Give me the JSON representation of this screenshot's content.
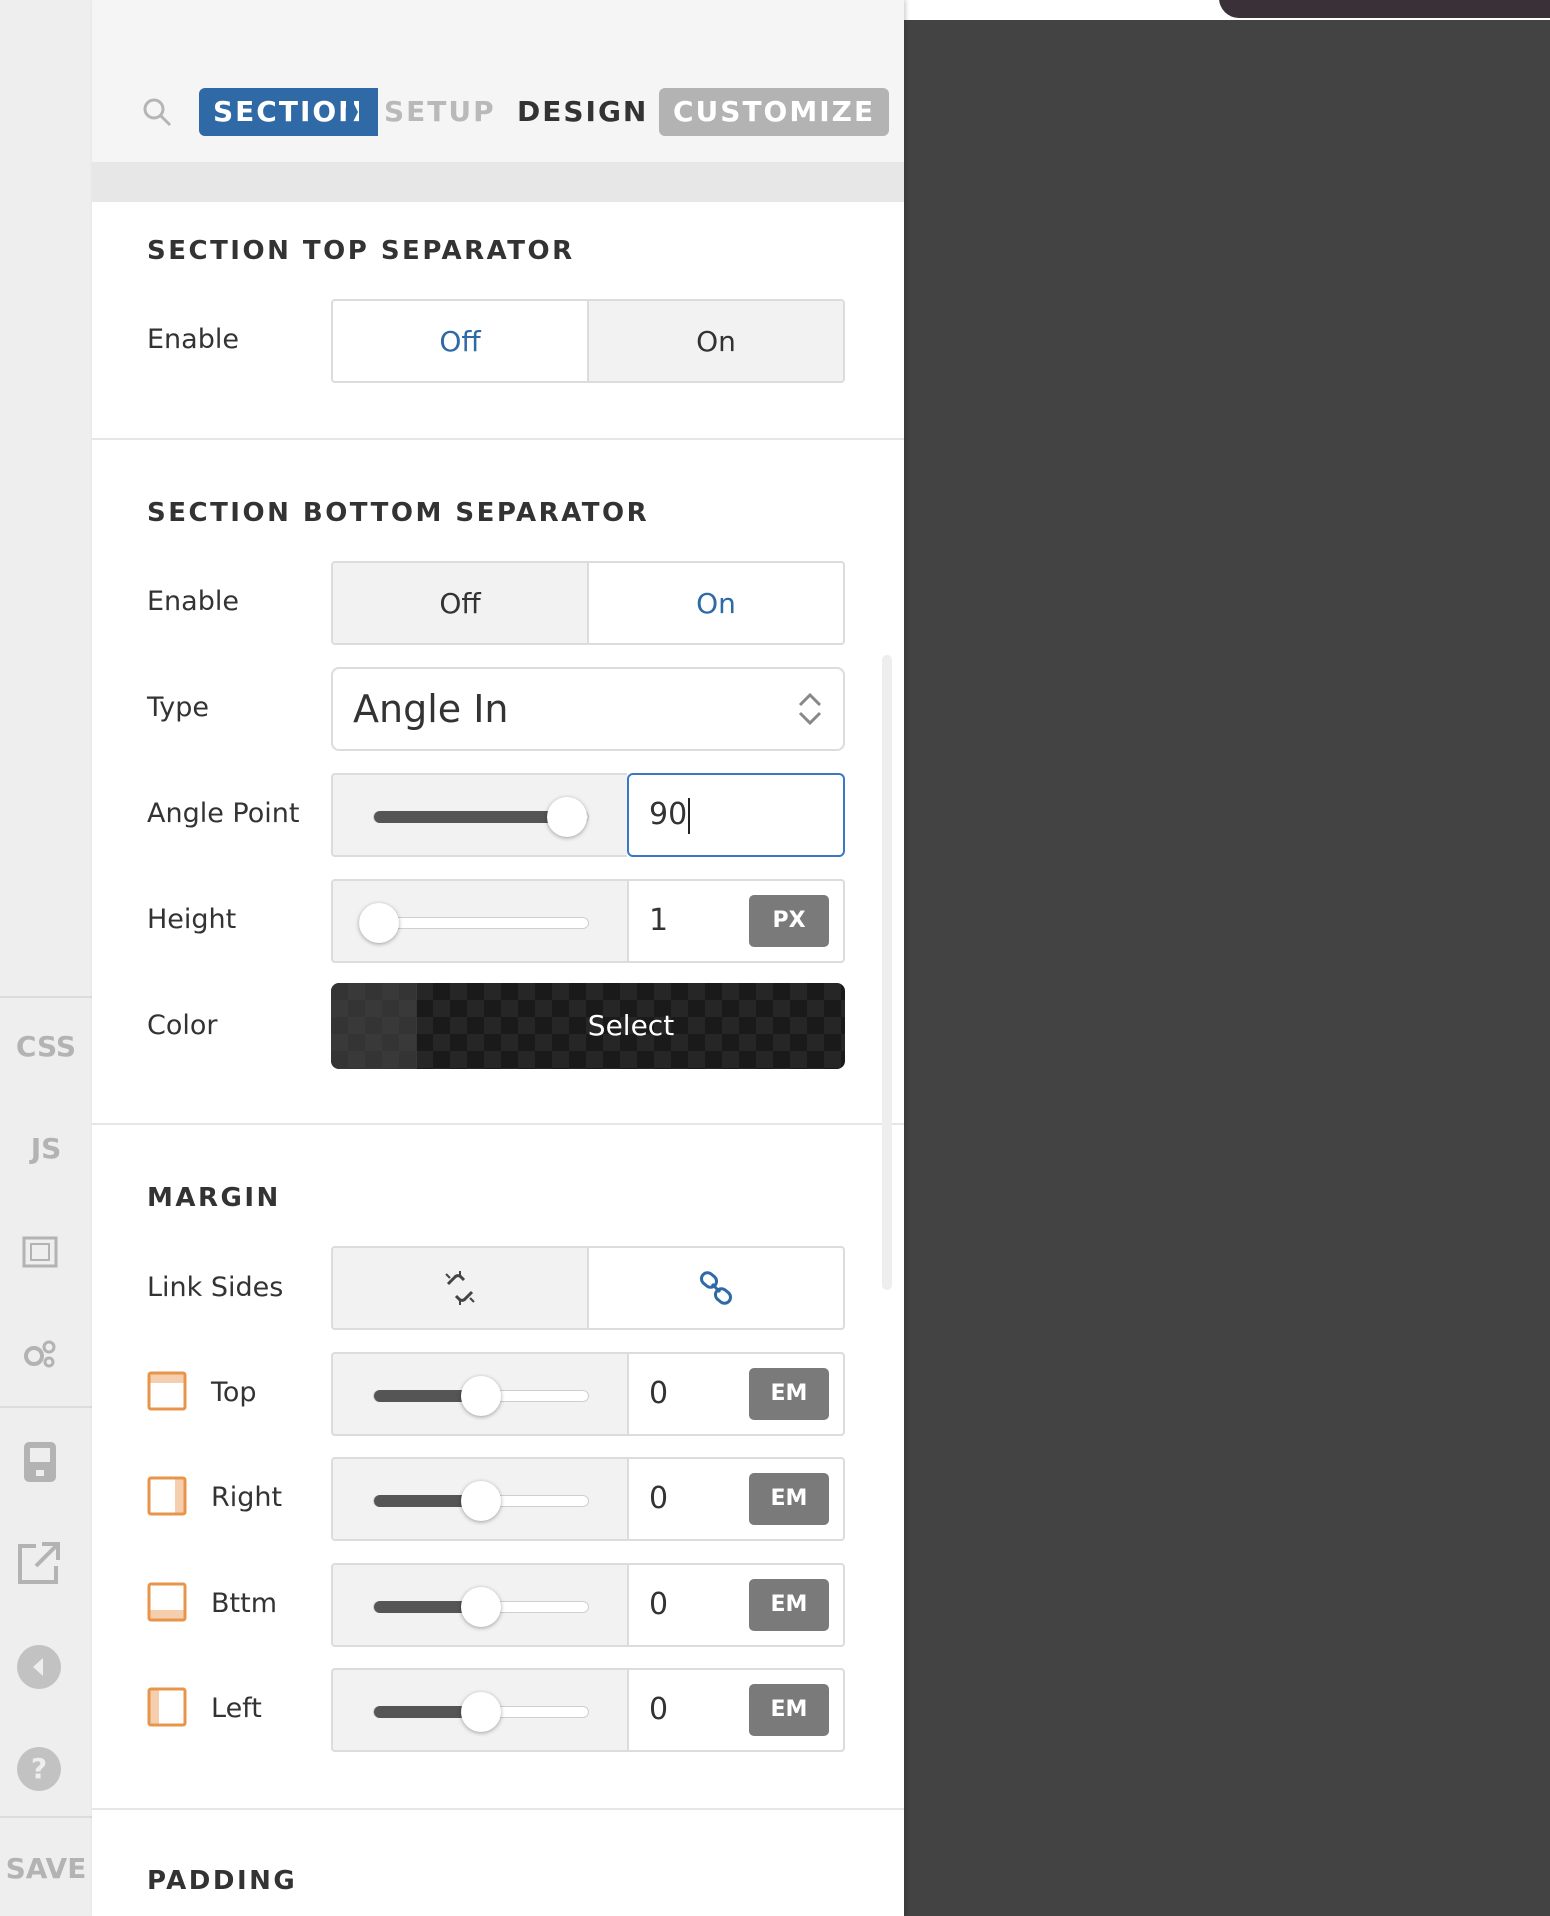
{
  "tabs": {
    "section": "SECTION",
    "setup": "SETUP",
    "design": "DESIGN",
    "customize": "CUSTOMIZE"
  },
  "rail": {
    "css": "CSS",
    "js": "JS",
    "save": "SAVE"
  },
  "top_separator": {
    "title": "SECTION TOP SEPARATOR",
    "enable_label": "Enable",
    "off": "Off",
    "on": "On",
    "selected": "Off"
  },
  "bottom_separator": {
    "title": "SECTION BOTTOM SEPARATOR",
    "enable_label": "Enable",
    "off": "Off",
    "on": "On",
    "selected": "On",
    "type_label": "Type",
    "type_value": "Angle In",
    "angle_label": "Angle Point",
    "angle_value": "90",
    "angle_fraction": 0.9,
    "height_label": "Height",
    "height_value": "1",
    "height_unit": "PX",
    "height_fraction": 0.0,
    "color_label": "Color",
    "color_button": "Select"
  },
  "margin": {
    "title": "MARGIN",
    "link_label": "Link Sides",
    "sides": [
      {
        "label": "Top",
        "value": "0",
        "unit": "EM"
      },
      {
        "label": "Right",
        "value": "0",
        "unit": "EM"
      },
      {
        "label": "Bttm",
        "value": "0",
        "unit": "EM"
      },
      {
        "label": "Left",
        "value": "0",
        "unit": "EM"
      }
    ],
    "slider_fraction": 0.5
  },
  "padding": {
    "title": "PADDING"
  },
  "colors": {
    "accent": "#2f6aa6",
    "side_icon": "#e8944a",
    "canvas_bg": "#434343"
  }
}
